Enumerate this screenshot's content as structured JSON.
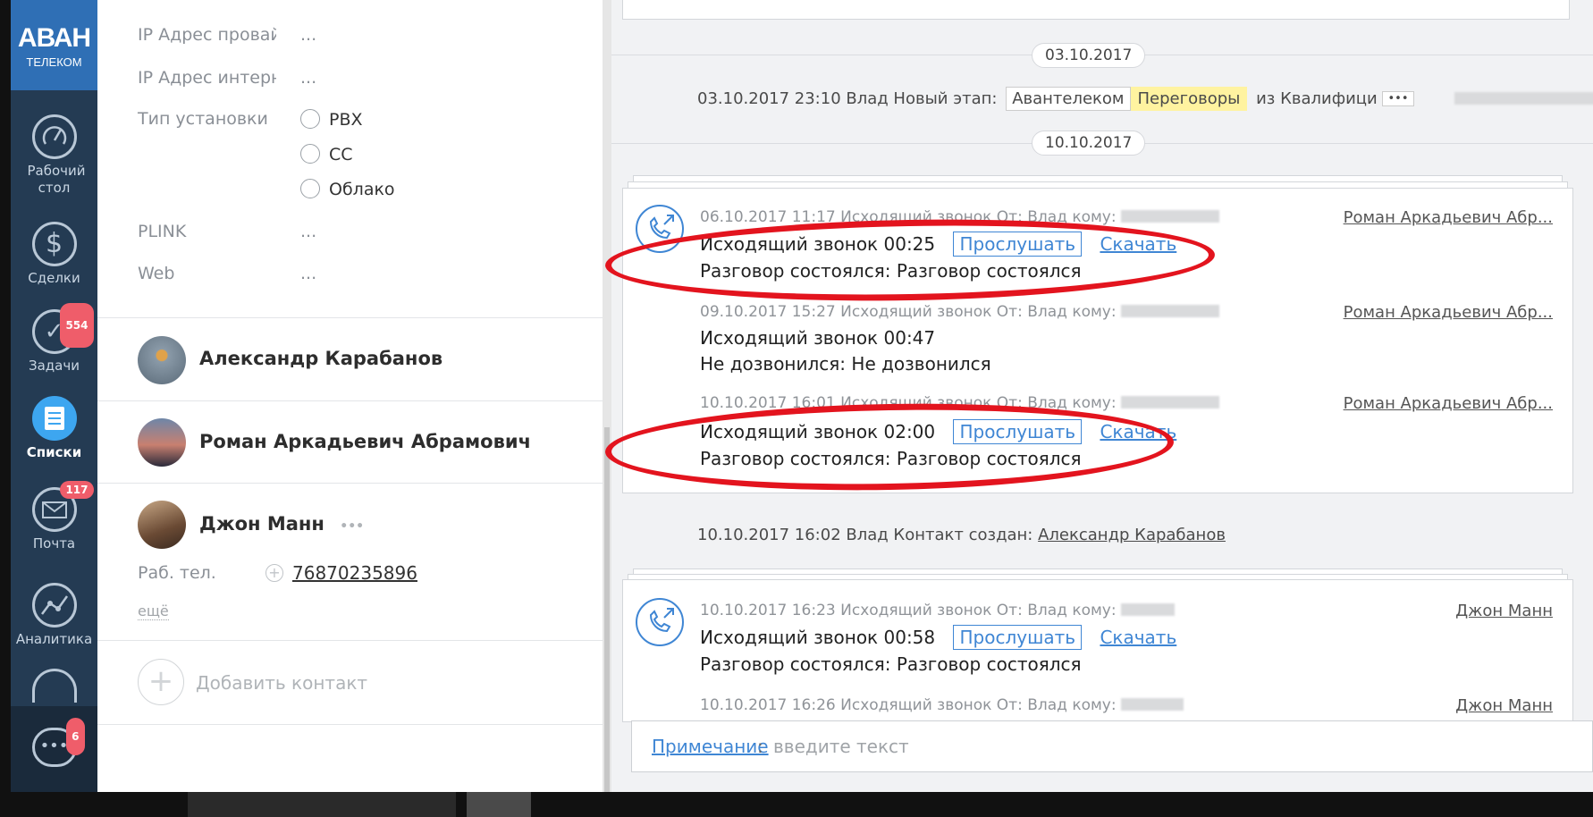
{
  "logo": {
    "line1": "АВАН",
    "line2": "ТЕЛЕКОМ"
  },
  "nav": [
    {
      "label": "Рабочий стол",
      "icon": "speedometer-icon"
    },
    {
      "label": "Сделки",
      "icon": "dollar-icon"
    },
    {
      "label": "Задачи",
      "icon": "checkmark-icon",
      "badge": "554"
    },
    {
      "label": "Списки",
      "icon": "list-icon",
      "active": true
    },
    {
      "label": "Почта",
      "icon": "mail-icon",
      "badge": "117"
    },
    {
      "label": "Аналитика",
      "icon": "analytics-icon"
    }
  ],
  "chat_badge": "6",
  "fields": {
    "ip_provider_label": "IP Адрес провай",
    "ip_provider_value": "...",
    "ip_internet_label": "IP Адрес интерн",
    "ip_internet_value": "...",
    "install_type_label": "Тип установки",
    "install_options": [
      "PBX",
      "CC",
      "Облако"
    ],
    "plink_label": "PLINK",
    "plink_value": "...",
    "web_label": "Web",
    "web_value": "..."
  },
  "contacts": [
    {
      "name": "Александр  Карабанов"
    },
    {
      "name": "Роман Аркадьевич Абрамович"
    },
    {
      "name": "Джон Манн",
      "more": "•••",
      "phone_label": "Раб. тел.",
      "phone": "76870235896",
      "more_link": "ещё"
    }
  ],
  "add_contact": "Добавить контакт",
  "timeline": {
    "date1": "03.10.2017",
    "stage_event": {
      "prefix": "03.10.2017 23:10 Влад Новый этап:",
      "tag1": "Авантелеком",
      "tag2": "Переговоры",
      "suffix": "из Квалифици",
      "more": "•••"
    },
    "date2": "10.10.2017",
    "card1": [
      {
        "meta": "06.10.2017 11:17 Исходящий звонок От: Влад кому:",
        "call": "Исходящий звонок 00:25",
        "listen": "Прослушать",
        "download": "Скачать",
        "result": "Разговор состоялся: Разговор состоялся",
        "person": "Роман Аркадьевич Абр..."
      },
      {
        "meta": "09.10.2017 15:27 Исходящий звонок От: Влад кому:",
        "call": "Исходящий звонок 00:47",
        "result": "Не дозвонился: Не дозвонился",
        "person": "Роман Аркадьевич Абр..."
      },
      {
        "meta": "10.10.2017 16:01 Исходящий звонок От: Влад кому:",
        "call": "Исходящий звонок 02:00",
        "listen": "Прослушать",
        "download": "Скачать",
        "result": "Разговор состоялся: Разговор состоялся",
        "person": "Роман Аркадьевич Абр..."
      }
    ],
    "contact_created": {
      "text": "10.10.2017 16:02 Влад Контакт создан:",
      "link": "Александр Карабанов"
    },
    "card2": [
      {
        "meta": "10.10.2017 16:23 Исходящий звонок От: Влад кому:",
        "call": "Исходящий звонок 00:58",
        "listen": "Прослушать",
        "download": "Скачать",
        "result": "Разговор состоялся: Разговор состоялся",
        "person": "Джон Манн"
      },
      {
        "meta": "10.10.2017 16:26 Исходящий звонок От: Влад кому:",
        "person": "Джон Манн"
      }
    ]
  },
  "note": {
    "label": "Примечание",
    "placeholder": "введите текст"
  },
  "colors": {
    "accent": "#3f86d4",
    "highlight_ellipse": "#e3141e",
    "nav_bg": "#243b53"
  }
}
